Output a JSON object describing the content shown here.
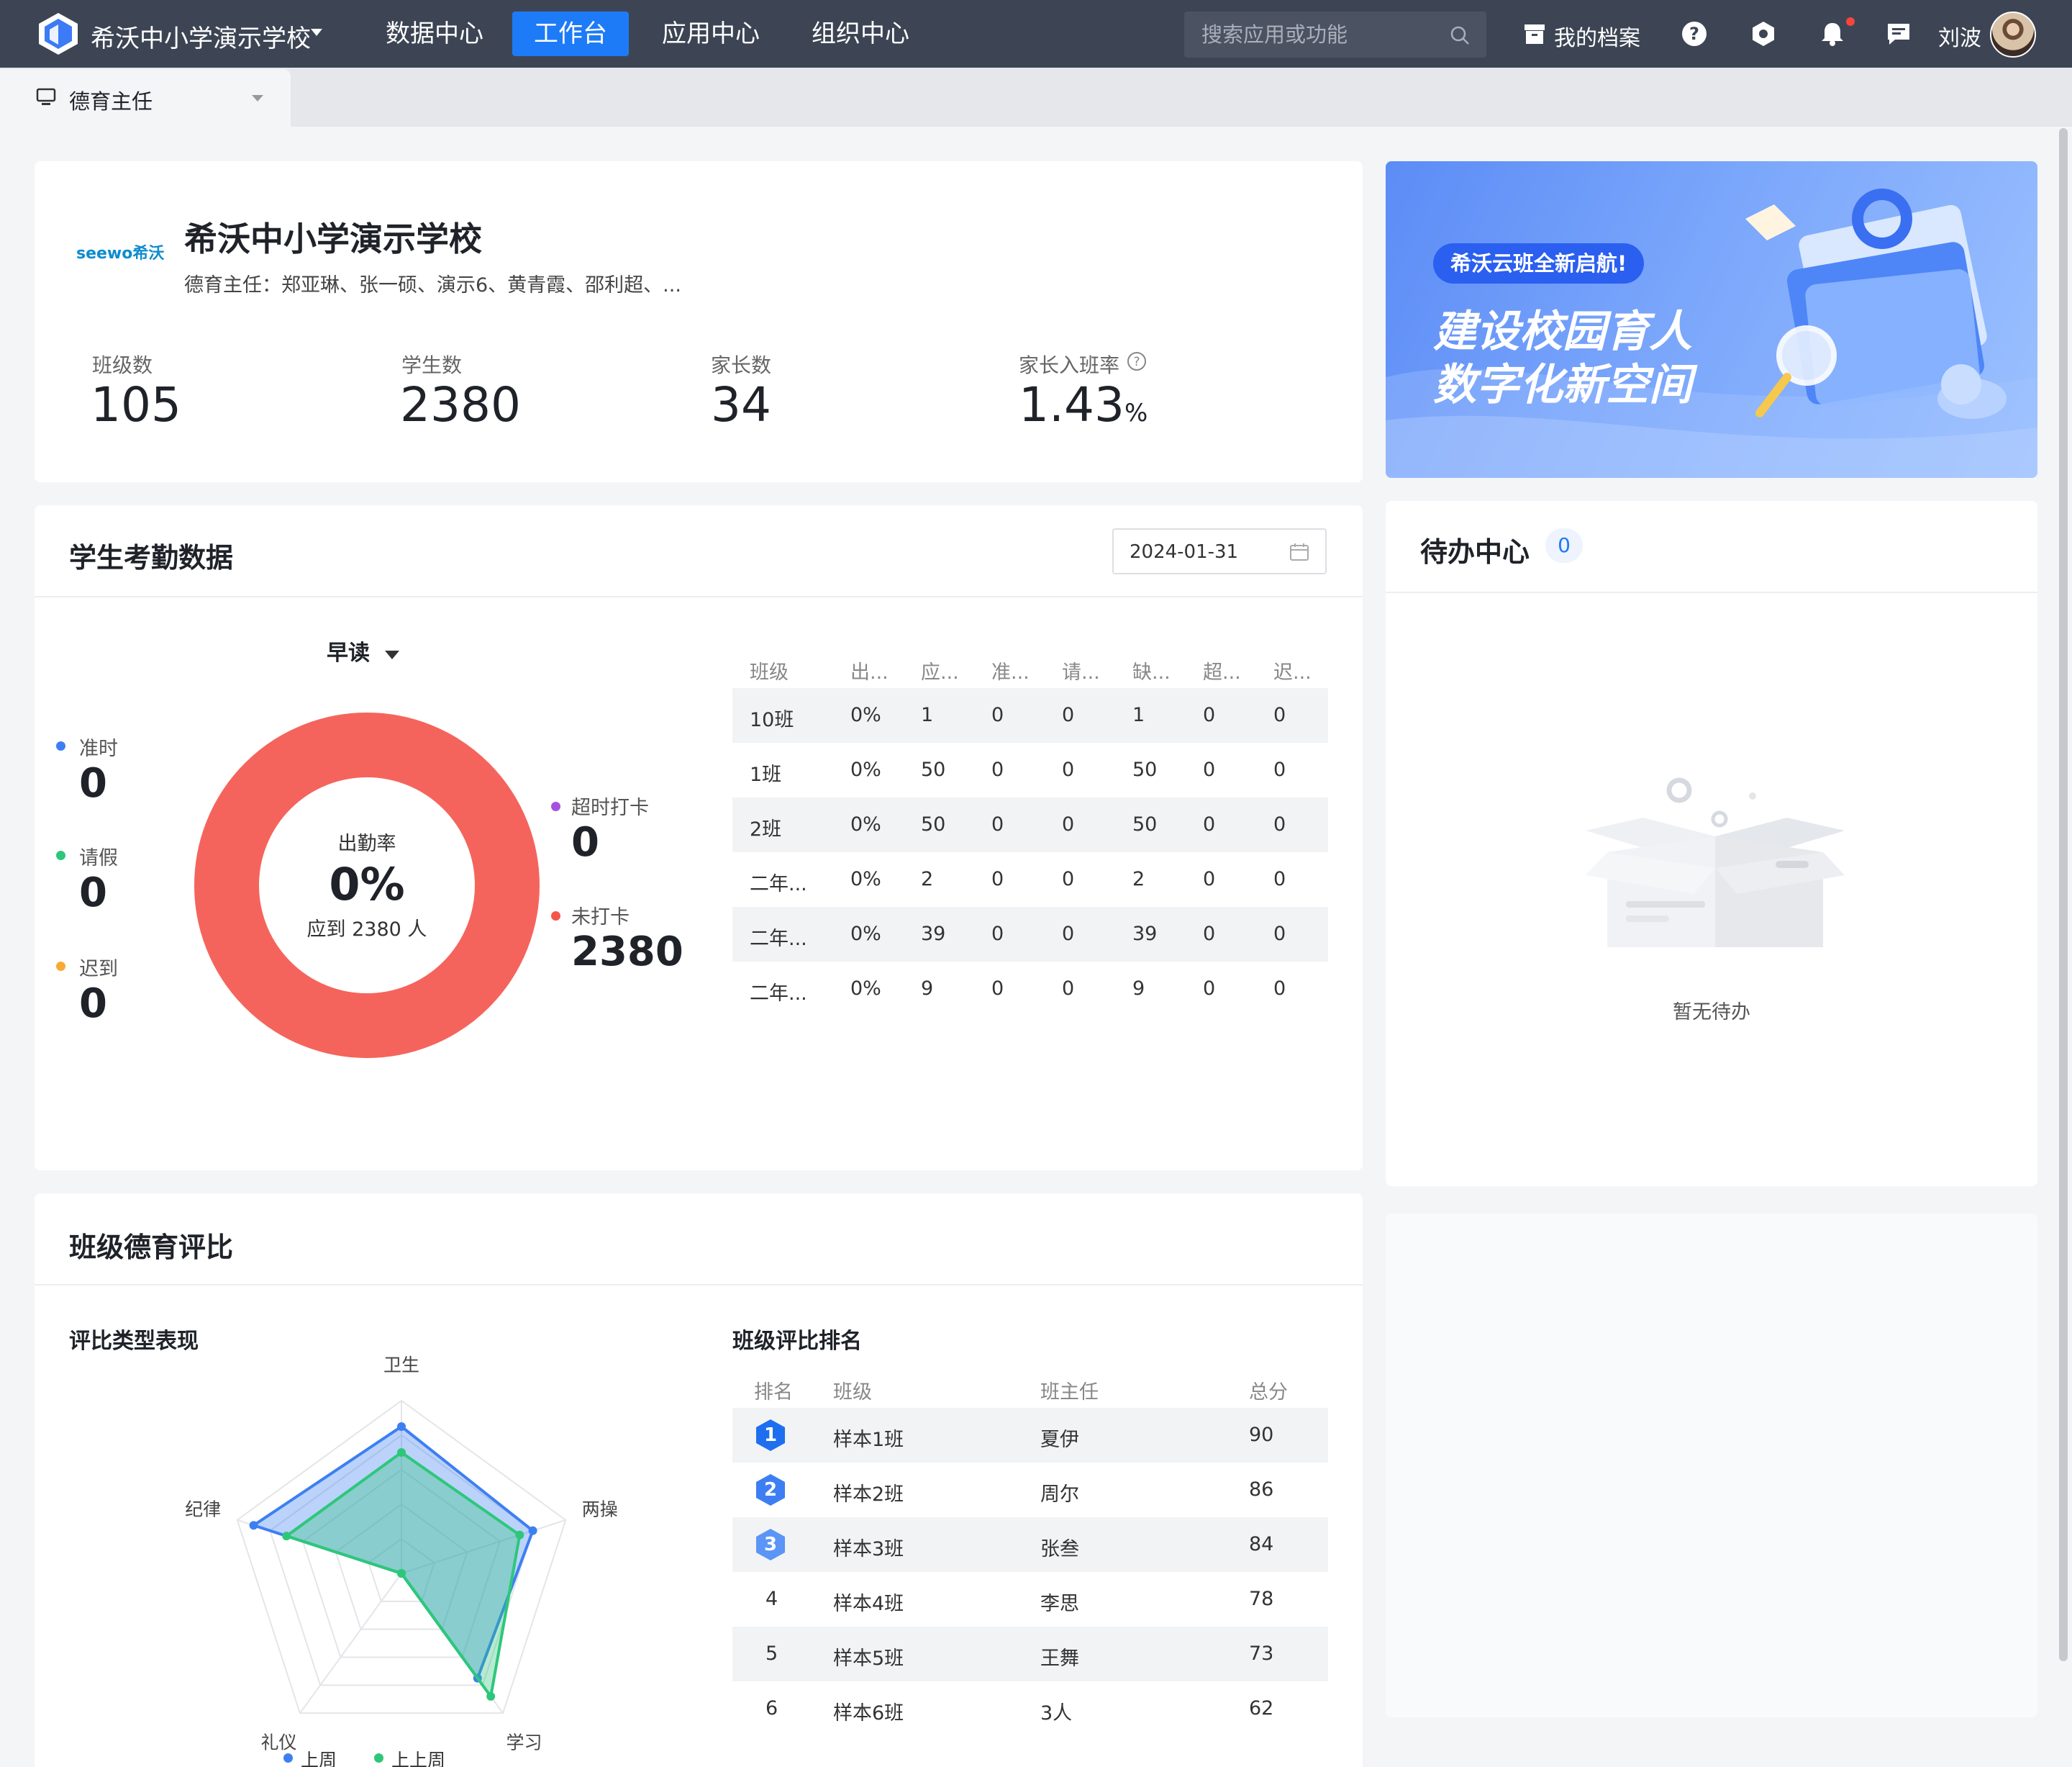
{
  "header": {
    "school_name": "希沃中小学演示学校",
    "nav": [
      "数据中心",
      "工作台",
      "应用中心",
      "组织中心"
    ],
    "active_nav": "工作台",
    "search_placeholder": "搜索应用或功能",
    "my_profile": "我的档案",
    "user_name": "刘波"
  },
  "role_tab": {
    "label": "德育主任"
  },
  "school_card": {
    "brand": "seewo希沃",
    "name": "希沃中小学演示学校",
    "staff": "德育主任：郑亚琳、张一硕、演示6、黄青霞、邵利超、...",
    "stats": [
      {
        "label": "班级数",
        "value": "105"
      },
      {
        "label": "学生数",
        "value": "2380"
      },
      {
        "label": "家长数",
        "value": "34"
      },
      {
        "label": "家长入班率",
        "value": "1.43",
        "unit": "%"
      }
    ]
  },
  "banner": {
    "tag": "希沃云班全新启航!",
    "line1": "建设校园育人",
    "line2": "数字化新空间"
  },
  "attendance": {
    "title": "学生考勤数据",
    "date": "2024-01-31",
    "period": "早读",
    "left_legend": [
      {
        "label": "准时",
        "value": "0",
        "color": "#3d7ff2"
      },
      {
        "label": "请假",
        "value": "0",
        "color": "#2ec77a"
      },
      {
        "label": "迟到",
        "value": "0",
        "color": "#f7a935"
      }
    ],
    "right_legend": [
      {
        "label": "超时打卡",
        "value": "0",
        "color": "#a64fe0"
      },
      {
        "label": "未打卡",
        "value": "2380",
        "color": "#f5544a"
      }
    ],
    "donut": {
      "caption": "出勤率",
      "rate": "0%",
      "sub": "应到 2380 人",
      "color": "#f5645c"
    },
    "columns": [
      "班级",
      "出...",
      "应...",
      "准...",
      "请...",
      "缺...",
      "超...",
      "迟..."
    ],
    "rows": [
      [
        "10班",
        "0%",
        "1",
        "0",
        "0",
        "1",
        "0",
        "0"
      ],
      [
        "1班",
        "0%",
        "50",
        "0",
        "0",
        "50",
        "0",
        "0"
      ],
      [
        "2班",
        "0%",
        "50",
        "0",
        "0",
        "50",
        "0",
        "0"
      ],
      [
        "二年...",
        "0%",
        "2",
        "0",
        "0",
        "2",
        "0",
        "0"
      ],
      [
        "二年...",
        "0%",
        "39",
        "0",
        "0",
        "39",
        "0",
        "0"
      ],
      [
        "二年...",
        "0%",
        "9",
        "0",
        "0",
        "9",
        "0",
        "0"
      ]
    ]
  },
  "todo": {
    "title": "待办中心",
    "count": "0",
    "empty_text": "暂无待办"
  },
  "moral": {
    "title": "班级德育评比",
    "radar_title": "评比类型表现",
    "ranking_title": "班级评比排名",
    "rank_columns": [
      "排名",
      "班级",
      "班主任",
      "总分"
    ],
    "ranks": [
      [
        "1",
        "样本1班",
        "夏伊",
        "90"
      ],
      [
        "2",
        "样本2班",
        "周尔",
        "86"
      ],
      [
        "3",
        "样本3班",
        "张叁",
        "84"
      ],
      [
        "4",
        "样本4班",
        "李思",
        "78"
      ],
      [
        "5",
        "样本5班",
        "王舞",
        "73"
      ],
      [
        "6",
        "样本6班",
        "3人",
        "62"
      ]
    ]
  },
  "chart_data": {
    "type": "radar",
    "categories": [
      "卫生",
      "两操",
      "学习",
      "礼仪",
      "纪律"
    ],
    "max": 100,
    "series": [
      {
        "name": "上周",
        "values": [
          85,
          80,
          75,
          0,
          90
        ],
        "color": "#3d7ff2"
      },
      {
        "name": "上上周",
        "values": [
          70,
          72,
          88,
          0,
          70
        ],
        "color": "#2ec77a"
      }
    ]
  }
}
